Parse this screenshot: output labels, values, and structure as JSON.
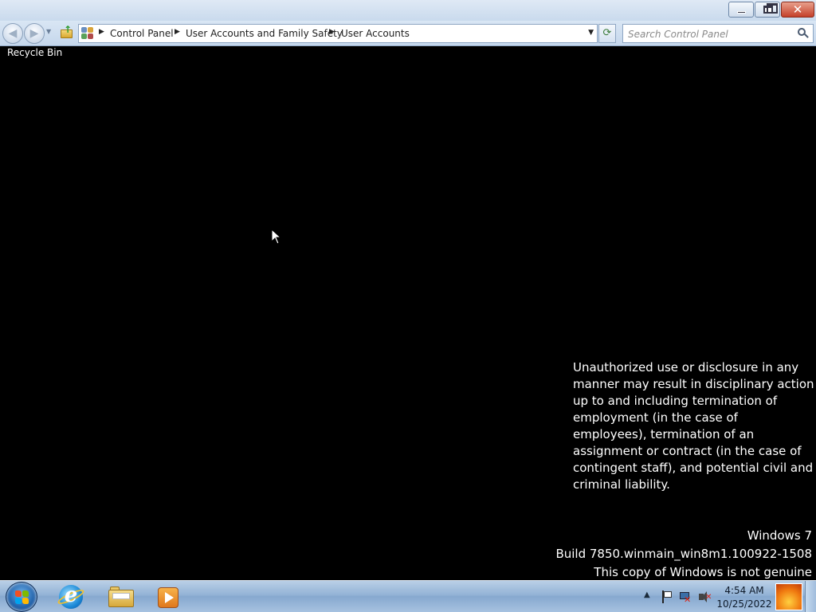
{
  "window": {
    "caption_buttons": [
      "minimize",
      "maximize",
      "close"
    ]
  },
  "navigation": {
    "breadcrumb": [
      {
        "label": "Control Panel"
      },
      {
        "label": "User Accounts and Family Safety"
      },
      {
        "label": "User Accounts"
      }
    ],
    "search_placeholder": "Search Control Panel",
    "icons": [
      "back-icon",
      "forward-icon",
      "up-folder-icon",
      "control-panel-icon",
      "refresh-icon",
      "search-icon"
    ]
  },
  "desktop": {
    "recycle_bin_label": "Recycle Bin",
    "notice": "Unauthorized use or disclosure in any manner may result in disciplinary action up to and including termination of employment (in the case of employees), termination of an assignment or contract (in the case of contingent staff), and potential civil and criminal liability.",
    "watermark": {
      "line1": "Windows 7",
      "line2": "Build 7850.winmain_win8m1.100922-1508",
      "line3": "This copy of Windows is not genuine"
    }
  },
  "taskbar": {
    "pinned": [
      {
        "name": "internet-explorer"
      },
      {
        "name": "windows-explorer"
      },
      {
        "name": "windows-media-player"
      }
    ],
    "clock": {
      "time": "4:54 AM",
      "date": "10/25/2022"
    }
  },
  "colors": {
    "desktop_background": "#000000",
    "taskbar": "#93b3d6",
    "text": "#ffffff"
  }
}
